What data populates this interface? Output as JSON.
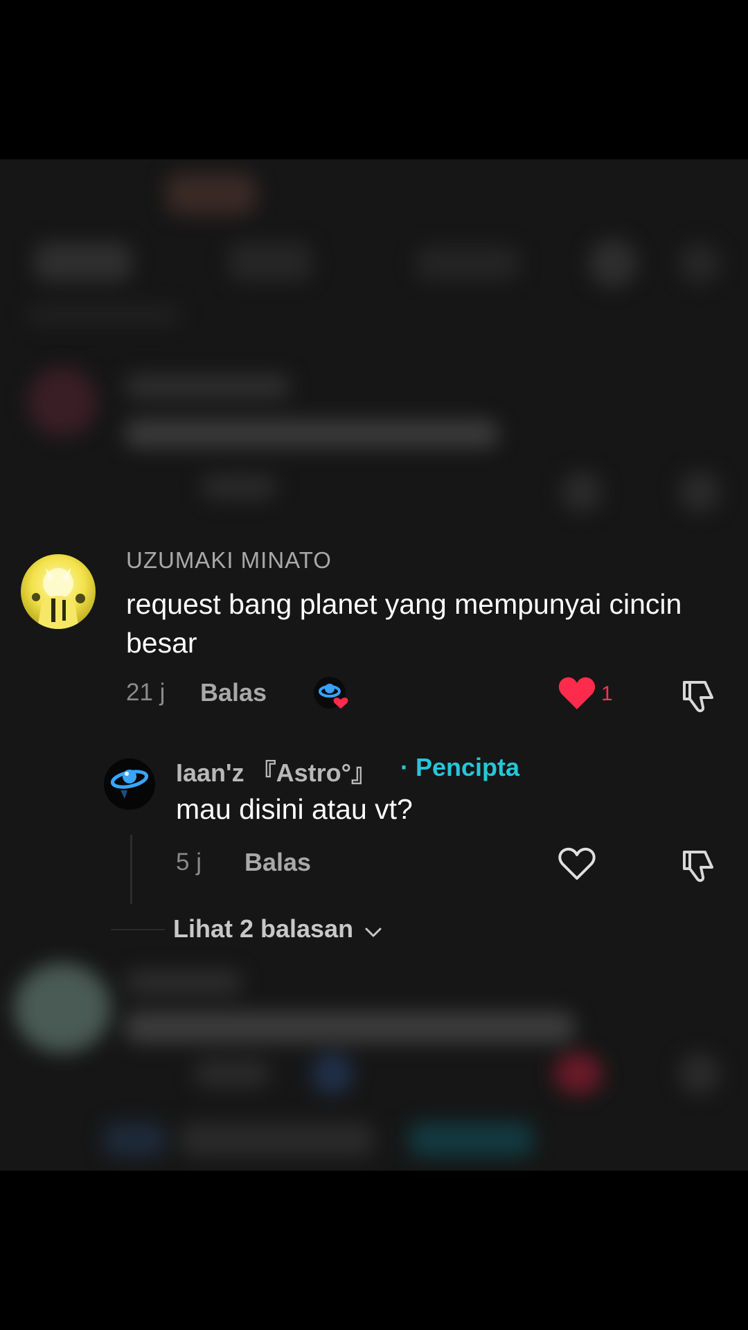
{
  "comment": {
    "username": "UZUMAKI MINATO",
    "text": "request bang planet yang mempunyai cincin besar",
    "time": "21 j",
    "reply_label": "Balas",
    "like_count": "1",
    "icons": [
      "avatar",
      "creator-liked-badge-icon",
      "heart-filled-icon",
      "dislike-icon"
    ]
  },
  "reply": {
    "username": "Iaan'z 『Astro°』",
    "badge": "· Pencipta",
    "text": "mau disini atau vt?",
    "time": "5 j",
    "reply_label": "Balas",
    "icons": [
      "avatar",
      "heart-outline-icon",
      "dislike-icon"
    ]
  },
  "view_replies": {
    "label": "Lihat 2 balasan",
    "icon": "chevron-down-icon"
  },
  "colors": {
    "background": "#161616",
    "like_active": "#ff2b4d",
    "creator_badge": "#26c6da",
    "text_primary": "#ffffff",
    "text_secondary": "#a9a9a9"
  }
}
